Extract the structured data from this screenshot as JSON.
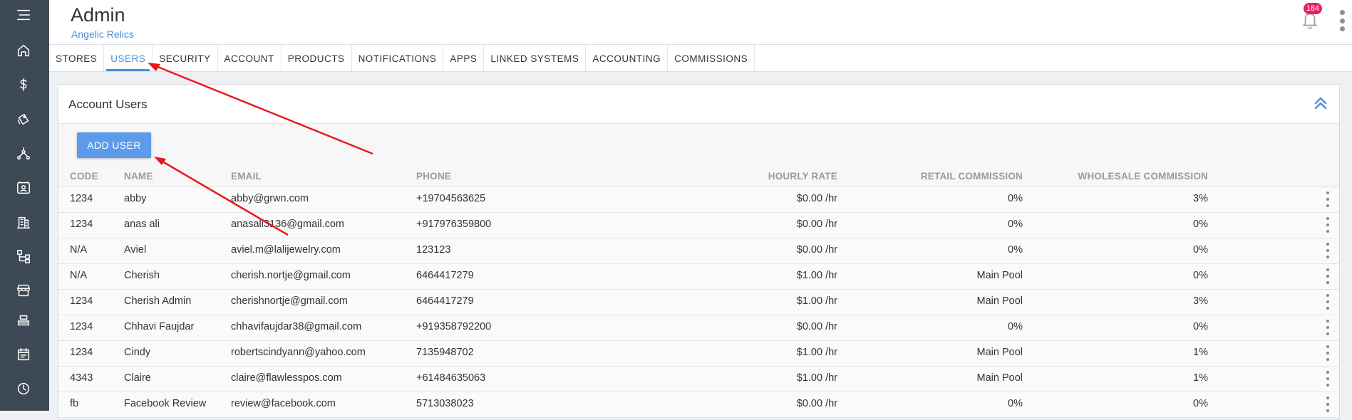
{
  "header": {
    "title": "Admin",
    "subtitle": "Angelic Relics",
    "notification_count": "184"
  },
  "sidebar": {
    "items": [
      {
        "icon": "menu-icon"
      },
      {
        "icon": "home-icon"
      },
      {
        "icon": "dollar-icon"
      },
      {
        "icon": "tag-icon"
      },
      {
        "icon": "network-icon"
      },
      {
        "icon": "contact-card-icon"
      },
      {
        "icon": "building-icon"
      },
      {
        "icon": "hierarchy-icon"
      },
      {
        "icon": "store-icon"
      },
      {
        "icon": "printer-icon"
      },
      {
        "icon": "calendar-icon"
      },
      {
        "icon": "clock-icon"
      }
    ]
  },
  "tabs": [
    {
      "label": "STORES"
    },
    {
      "label": "USERS",
      "active": true
    },
    {
      "label": "SECURITY"
    },
    {
      "label": "ACCOUNT"
    },
    {
      "label": "PRODUCTS"
    },
    {
      "label": "NOTIFICATIONS"
    },
    {
      "label": "APPS"
    },
    {
      "label": "LINKED SYSTEMS"
    },
    {
      "label": "ACCOUNTING"
    },
    {
      "label": "COMMISSIONS"
    }
  ],
  "card": {
    "title": "Account Users",
    "add_button": "ADD USER"
  },
  "table": {
    "columns": [
      "CODE",
      "NAME",
      "EMAIL",
      "PHONE",
      "HOURLY RATE",
      "RETAIL COMMISSION",
      "WHOLESALE COMMISSION"
    ],
    "rows": [
      {
        "code": "1234",
        "name": "abby",
        "email": "abby@grwn.com",
        "phone": "+19704563625",
        "rate": "$0.00 /hr",
        "retail": "0%",
        "wholesale": "3%"
      },
      {
        "code": "1234",
        "name": "anas ali",
        "email": "anasali3136@gmail.com",
        "phone": "+917976359800",
        "rate": "$0.00 /hr",
        "retail": "0%",
        "wholesale": "0%"
      },
      {
        "code": "N/A",
        "name": "Aviel",
        "email": "aviel.m@lalijewelry.com",
        "phone": "123123",
        "rate": "$0.00 /hr",
        "retail": "0%",
        "wholesale": "0%"
      },
      {
        "code": "N/A",
        "name": "Cherish",
        "email": "cherish.nortje@gmail.com",
        "phone": "6464417279",
        "rate": "$1.00 /hr",
        "retail": "Main Pool",
        "wholesale": "0%"
      },
      {
        "code": "1234",
        "name": "Cherish Admin",
        "email": "cherishnortje@gmail.com",
        "phone": "6464417279",
        "rate": "$1.00 /hr",
        "retail": "Main Pool",
        "wholesale": "3%"
      },
      {
        "code": "1234",
        "name": "Chhavi Faujdar",
        "email": "chhavifaujdar38@gmail.com",
        "phone": "+919358792200",
        "rate": "$0.00 /hr",
        "retail": "0%",
        "wholesale": "0%"
      },
      {
        "code": "1234",
        "name": "Cindy",
        "email": "robertscindyann@yahoo.com",
        "phone": "7135948702",
        "rate": "$1.00 /hr",
        "retail": "Main Pool",
        "wholesale": "1%"
      },
      {
        "code": "4343",
        "name": "Claire",
        "email": "claire@flawlesspos.com",
        "phone": "+61484635063",
        "rate": "$1.00 /hr",
        "retail": "Main Pool",
        "wholesale": "1%"
      },
      {
        "code": "fb",
        "name": "Facebook Review",
        "email": "review@facebook.com",
        "phone": "5713038023",
        "rate": "$0.00 /hr",
        "retail": "0%",
        "wholesale": "0%"
      }
    ]
  },
  "annotations": {
    "arrow_color": "#e8191c"
  }
}
